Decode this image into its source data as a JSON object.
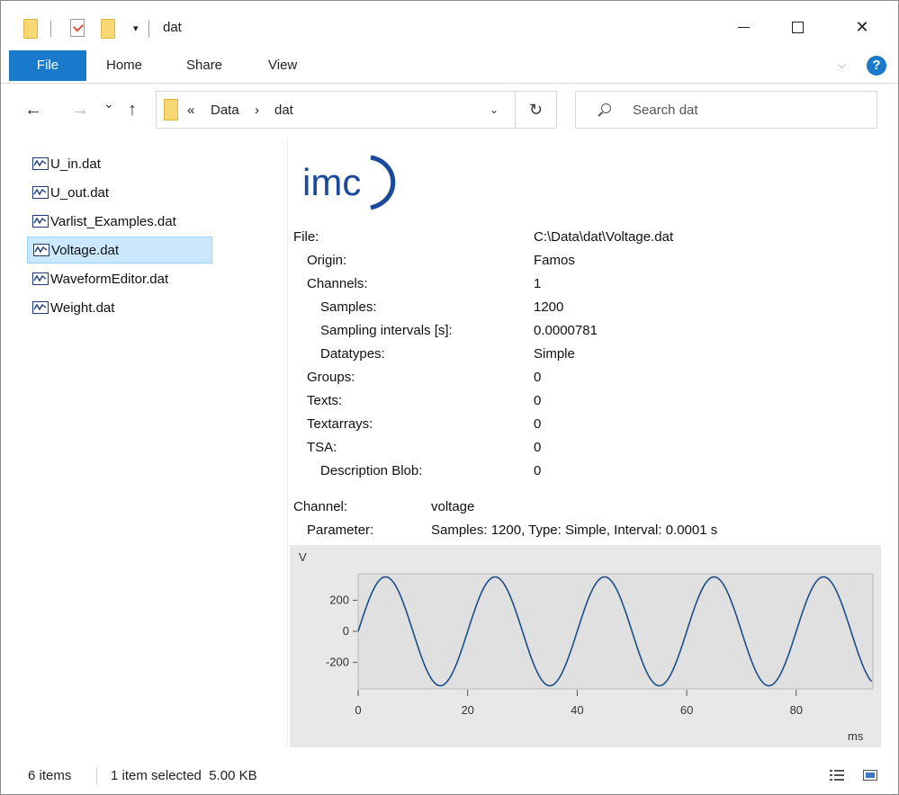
{
  "window": {
    "title": "dat",
    "qa_dropdown": "▾",
    "min_glyph": "",
    "close_glyph": "✕"
  },
  "ribbon": {
    "tabs": [
      "File",
      "Home",
      "Share",
      "View"
    ],
    "chevron": "⌵",
    "help": "?"
  },
  "nav": {
    "back": "←",
    "forward": "→",
    "recent": "⌄",
    "up": "↑",
    "breadcrumb_overflow": "«",
    "breadcrumb": [
      "Data",
      "dat"
    ],
    "crumb_sep": "›",
    "address_dropdown": "⌄",
    "refresh": "↻",
    "search_placeholder": "Search dat"
  },
  "files": [
    {
      "name": "U_in.dat",
      "selected": false
    },
    {
      "name": "U_out.dat",
      "selected": false
    },
    {
      "name": "Varlist_Examples.dat",
      "selected": false
    },
    {
      "name": "Voltage.dat",
      "selected": true
    },
    {
      "name": "WaveformEditor.dat",
      "selected": false
    },
    {
      "name": "Weight.dat",
      "selected": false
    }
  ],
  "preview": {
    "logo_text": "imc",
    "logo_color": "#1a4a9c",
    "properties": [
      {
        "label": "File:",
        "value": "C:\\Data\\dat\\Voltage.dat",
        "indent": 0
      },
      {
        "label": "Origin:",
        "value": "Famos",
        "indent": 1
      },
      {
        "label": "Channels:",
        "value": "1",
        "indent": 1
      },
      {
        "label": "Samples:",
        "value": "1200",
        "indent": 2
      },
      {
        "label": "Sampling intervals [s]:",
        "value": "0.0000781",
        "indent": 2
      },
      {
        "label": "Datatypes:",
        "value": "Simple",
        "indent": 2
      },
      {
        "label": "Groups:",
        "value": "0",
        "indent": 1
      },
      {
        "label": "Texts:",
        "value": "0",
        "indent": 1
      },
      {
        "label": "Textarrays:",
        "value": "0",
        "indent": 1
      },
      {
        "label": "TSA:",
        "value": "0",
        "indent": 1
      },
      {
        "label": "Description Blob:",
        "value": "0",
        "indent": 2
      }
    ],
    "channel": {
      "label": "Channel:",
      "value": "voltage",
      "param_label": "Parameter:",
      "param_value": "Samples: 1200, Type: Simple, Interval: 0.0001 s"
    }
  },
  "chart_data": {
    "type": "line",
    "title": "",
    "xlabel": "ms",
    "ylabel": "V",
    "xlim": [
      0,
      94
    ],
    "ylim": [
      -370,
      370
    ],
    "x_ticks": [
      0,
      20,
      40,
      60,
      80
    ],
    "y_ticks": [
      200,
      0,
      -200
    ],
    "y_tick_labels": [
      "200",
      "0",
      "-200"
    ],
    "grid": false,
    "line_color": "#1b4f8a",
    "series": [
      {
        "function": "sine",
        "amplitude": 350,
        "period_ms": 20,
        "phase_deg": 0,
        "x_start": 0,
        "x_end": 93.75
      }
    ]
  },
  "status": {
    "item_count": "6 items",
    "selection": "1 item selected  5.00 KB"
  }
}
